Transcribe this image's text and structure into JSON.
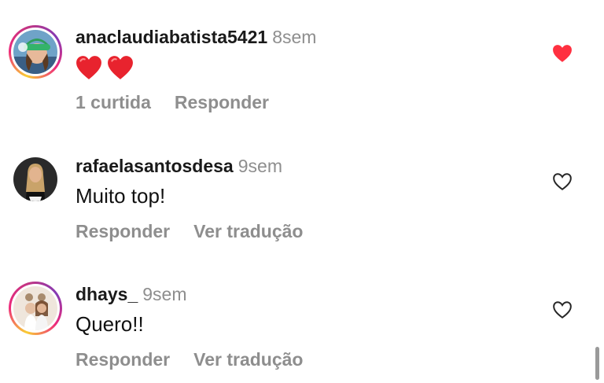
{
  "comments": [
    {
      "username": "anaclaudiabatista5421",
      "time": "8sem",
      "text": "",
      "emojis": [
        "red-heart",
        "red-heart"
      ],
      "liked": true,
      "actions": [
        "1 curtida",
        "Responder"
      ]
    },
    {
      "username": "rafaelasantosdesa",
      "time": "9sem",
      "text": "Muito top!",
      "liked": false,
      "actions": [
        "Responder",
        "Ver tradução"
      ]
    },
    {
      "username": "dhays_",
      "time": "9sem",
      "text": "Quero!!",
      "liked": false,
      "actions": [
        "Responder",
        "Ver tradução"
      ]
    }
  ],
  "colors": {
    "like_red": "#ff3040",
    "muted_text": "#8e8e8e",
    "story_ring_start": "#f9ce34",
    "story_ring_end": "#c13584"
  }
}
